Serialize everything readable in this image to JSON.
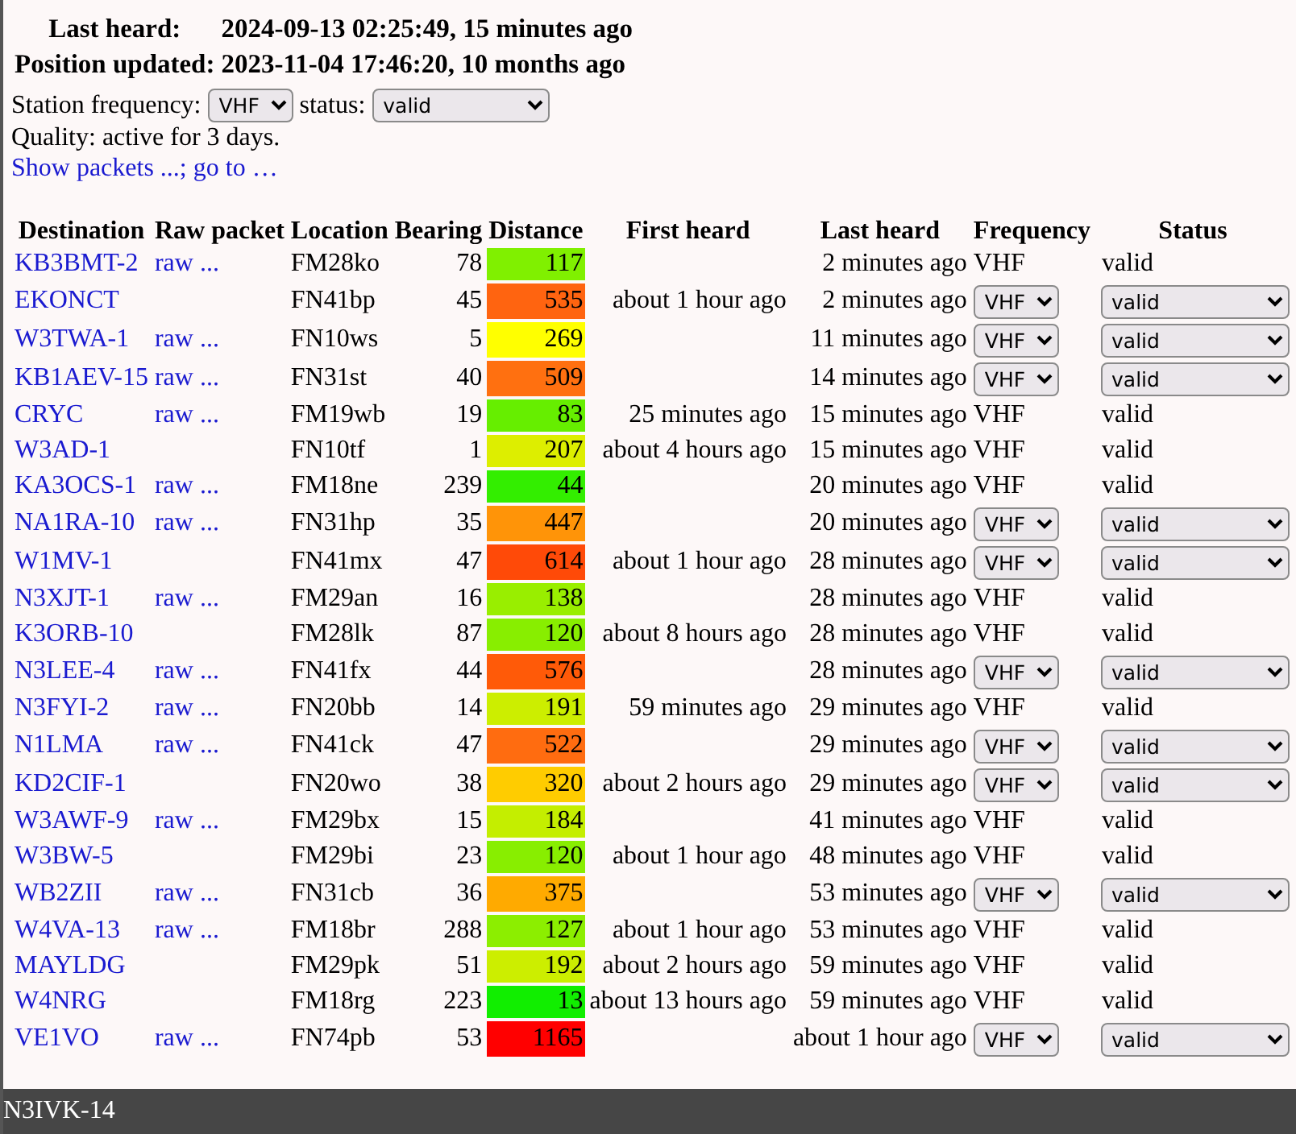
{
  "station": {
    "last_heard_label": "Last heard:",
    "last_heard": "2024-09-13 02:25:49, 15 minutes ago",
    "position_label": "Position updated:",
    "position": "2023-11-04 17:46:20, 10 months ago",
    "frequency_label": "Station frequency:",
    "frequency": "VHF",
    "status_label": "status:",
    "status": "valid",
    "quality": "Quality: active for 3 days.",
    "links": "Show packets ...; go to …"
  },
  "table": {
    "columns": [
      "Destination",
      "Raw packet",
      "Location",
      "Bearing",
      "Distance",
      "First heard",
      "Last heard",
      "Frequency",
      "Status"
    ],
    "rows": [
      {
        "destination": "KB3BMT-2",
        "raw": "raw ...",
        "location": "FM28ko",
        "bearing": "78",
        "distance": "117",
        "color": "#80f000",
        "first_heard": "",
        "last_heard": "2 minutes ago",
        "kind": "text",
        "frequency": "VHF",
        "status": "valid"
      },
      {
        "destination": "EKONCT",
        "raw": "",
        "location": "FN41bp",
        "bearing": "45",
        "distance": "535",
        "color": "#ff6410",
        "first_heard": "about 1 hour ago",
        "last_heard": "2 minutes ago",
        "kind": "select",
        "frequency": "VHF",
        "status": "valid"
      },
      {
        "destination": "W3TWA-1",
        "raw": "raw ...",
        "location": "FN10ws",
        "bearing": "5",
        "distance": "269",
        "color": "#ffff00",
        "first_heard": "",
        "last_heard": "11 minutes ago",
        "kind": "select",
        "frequency": "VHF",
        "status": "valid"
      },
      {
        "destination": "KB1AEV-15",
        "raw": "raw ...",
        "location": "FN31st",
        "bearing": "40",
        "distance": "509",
        "color": "#ff7010",
        "first_heard": "",
        "last_heard": "14 minutes ago",
        "kind": "select",
        "frequency": "VHF",
        "status": "valid"
      },
      {
        "destination": "CRYC",
        "raw": "raw ...",
        "location": "FM19wb",
        "bearing": "19",
        "distance": "83",
        "color": "#66ee00",
        "first_heard": "25 minutes ago",
        "last_heard": "15 minutes ago",
        "kind": "text",
        "frequency": "VHF",
        "status": "valid"
      },
      {
        "destination": "W3AD-1",
        "raw": "",
        "location": "FN10tf",
        "bearing": "1",
        "distance": "207",
        "color": "#ddee00",
        "first_heard": "about 4 hours ago",
        "last_heard": "15 minutes ago",
        "kind": "text",
        "frequency": "VHF",
        "status": "valid"
      },
      {
        "destination": "KA3OCS-1",
        "raw": "raw ...",
        "location": "FM18ne",
        "bearing": "239",
        "distance": "44",
        "color": "#33ee00",
        "first_heard": "",
        "last_heard": "20 minutes ago",
        "kind": "text",
        "frequency": "VHF",
        "status": "valid"
      },
      {
        "destination": "NA1RA-10",
        "raw": "raw ...",
        "location": "FN31hp",
        "bearing": "35",
        "distance": "447",
        "color": "#ff9408",
        "first_heard": "",
        "last_heard": "20 minutes ago",
        "kind": "select",
        "frequency": "VHF",
        "status": "valid"
      },
      {
        "destination": "W1MV-1",
        "raw": "",
        "location": "FN41mx",
        "bearing": "47",
        "distance": "614",
        "color": "#ff4a08",
        "first_heard": "about 1 hour ago",
        "last_heard": "28 minutes ago",
        "kind": "select",
        "frequency": "VHF",
        "status": "valid"
      },
      {
        "destination": "N3XJT-1",
        "raw": "raw ...",
        "location": "FM29an",
        "bearing": "16",
        "distance": "138",
        "color": "#99ee00",
        "first_heard": "",
        "last_heard": "28 minutes ago",
        "kind": "text",
        "frequency": "VHF",
        "status": "valid"
      },
      {
        "destination": "K3ORB-10",
        "raw": "",
        "location": "FM28lk",
        "bearing": "87",
        "distance": "120",
        "color": "#88ee00",
        "first_heard": "about 8 hours ago",
        "last_heard": "28 minutes ago",
        "kind": "text",
        "frequency": "VHF",
        "status": "valid"
      },
      {
        "destination": "N3LEE-4",
        "raw": "raw ...",
        "location": "FN41fx",
        "bearing": "44",
        "distance": "576",
        "color": "#ff5a08",
        "first_heard": "",
        "last_heard": "28 minutes ago",
        "kind": "select",
        "frequency": "VHF",
        "status": "valid"
      },
      {
        "destination": "N3FYI-2",
        "raw": "raw ...",
        "location": "FN20bb",
        "bearing": "14",
        "distance": "191",
        "color": "#ccee00",
        "first_heard": "59 minutes ago",
        "last_heard": "29 minutes ago",
        "kind": "text",
        "frequency": "VHF",
        "status": "valid"
      },
      {
        "destination": "N1LMA",
        "raw": "raw ...",
        "location": "FN41ck",
        "bearing": "47",
        "distance": "522",
        "color": "#ff6c10",
        "first_heard": "",
        "last_heard": "29 minutes ago",
        "kind": "select",
        "frequency": "VHF",
        "status": "valid"
      },
      {
        "destination": "KD2CIF-1",
        "raw": "",
        "location": "FN20wo",
        "bearing": "38",
        "distance": "320",
        "color": "#ffcc00",
        "first_heard": "about 2 hours ago",
        "last_heard": "29 minutes ago",
        "kind": "select",
        "frequency": "VHF",
        "status": "valid"
      },
      {
        "destination": "W3AWF-9",
        "raw": "raw ...",
        "location": "FM29bx",
        "bearing": "15",
        "distance": "184",
        "color": "#c4ee00",
        "first_heard": "",
        "last_heard": "41 minutes ago",
        "kind": "text",
        "frequency": "VHF",
        "status": "valid"
      },
      {
        "destination": "W3BW-5",
        "raw": "",
        "location": "FM29bi",
        "bearing": "23",
        "distance": "120",
        "color": "#88ee00",
        "first_heard": "about 1 hour ago",
        "last_heard": "48 minutes ago",
        "kind": "text",
        "frequency": "VHF",
        "status": "valid"
      },
      {
        "destination": "WB2ZII",
        "raw": "raw ...",
        "location": "FN31cb",
        "bearing": "36",
        "distance": "375",
        "color": "#ffaa00",
        "first_heard": "",
        "last_heard": "53 minutes ago",
        "kind": "select",
        "frequency": "VHF",
        "status": "valid"
      },
      {
        "destination": "W4VA-13",
        "raw": "raw ...",
        "location": "FM18br",
        "bearing": "288",
        "distance": "127",
        "color": "#8cee00",
        "first_heard": "about 1 hour ago",
        "last_heard": "53 minutes ago",
        "kind": "text",
        "frequency": "VHF",
        "status": "valid"
      },
      {
        "destination": "MAYLDG",
        "raw": "",
        "location": "FM29pk",
        "bearing": "51",
        "distance": "192",
        "color": "#ccee00",
        "first_heard": "about 2 hours ago",
        "last_heard": "59 minutes ago",
        "kind": "text",
        "frequency": "VHF",
        "status": "valid"
      },
      {
        "destination": "W4NRG",
        "raw": "",
        "location": "FM18rg",
        "bearing": "223",
        "distance": "13",
        "color": "#11ee00",
        "first_heard": "about 13 hours ago",
        "last_heard": "59 minutes ago",
        "kind": "text",
        "frequency": "VHF",
        "status": "valid"
      },
      {
        "destination": "VE1VO",
        "raw": "raw ...",
        "location": "FN74pb",
        "bearing": "53",
        "distance": "1165",
        "color": "#ff0000",
        "first_heard": "",
        "last_heard": "about 1 hour ago",
        "kind": "select",
        "frequency": "VHF",
        "status": "valid"
      }
    ]
  },
  "footer": {
    "title": "N3IVK-14"
  }
}
